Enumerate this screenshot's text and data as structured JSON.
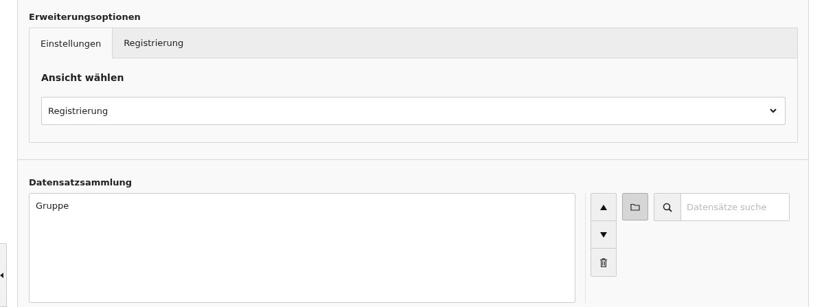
{
  "section_title": "Erweiterungsoptionen",
  "tabs": [
    {
      "label": "Einstellungen",
      "selected": true
    },
    {
      "label": "Registrierung",
      "selected": false
    }
  ],
  "view_select": {
    "label": "Ansicht wählen",
    "value": "Registrierung"
  },
  "records": {
    "label": "Datensatzsammlung",
    "items": [
      "Gruppe"
    ],
    "move_buttons": [
      {
        "kind": "up"
      },
      {
        "kind": "down"
      },
      {
        "kind": "delete"
      }
    ],
    "browse_button": {
      "pressed": true
    },
    "search": {
      "placeholder": "Datensätze suche"
    }
  }
}
